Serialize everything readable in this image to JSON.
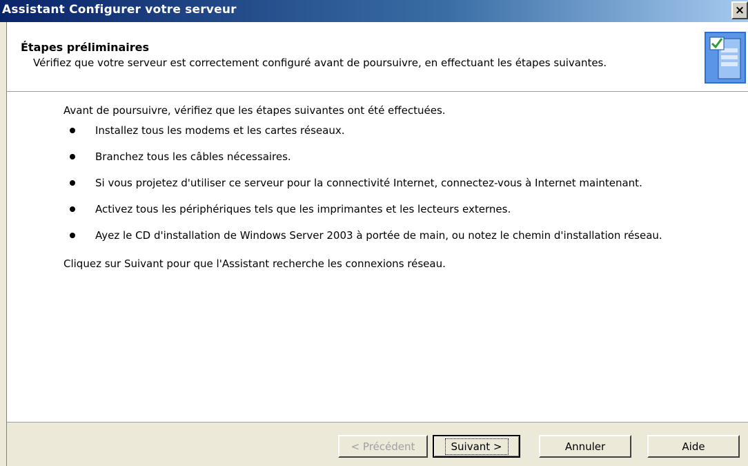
{
  "window": {
    "title": "Assistant Configurer votre serveur",
    "close_label": "×"
  },
  "header": {
    "title": "Étapes préliminaires",
    "subtitle": "Vérifiez que votre serveur est correctement configuré avant de poursuivre, en effectuant les étapes suivantes.",
    "icon": "server-wizard-icon"
  },
  "content": {
    "intro": "Avant de poursuivre, vérifiez que les étapes suivantes ont été effectuées.",
    "steps": [
      "Installez tous les modems et les cartes réseaux.",
      "Branchez tous les câbles nécessaires.",
      "Si vous projetez d'utiliser ce serveur pour la connectivité Internet, connectez-vous à Internet maintenant.",
      "Activez tous les périphériques tels que les imprimantes et les lecteurs externes.",
      "Ayez le CD d'installation de Windows Server 2003 à portée de main, ou notez le chemin d'installation réseau."
    ],
    "outro": "Cliquez sur Suivant pour que l'Assistant recherche les connexions réseau."
  },
  "buttons": {
    "previous": "< Précédent",
    "next": "Suivant >",
    "cancel": "Annuler",
    "help": "Aide"
  },
  "colors": {
    "titlebar_start": "#0a246a",
    "titlebar_end": "#a6caf0",
    "dialog_face": "#ece9d8"
  }
}
